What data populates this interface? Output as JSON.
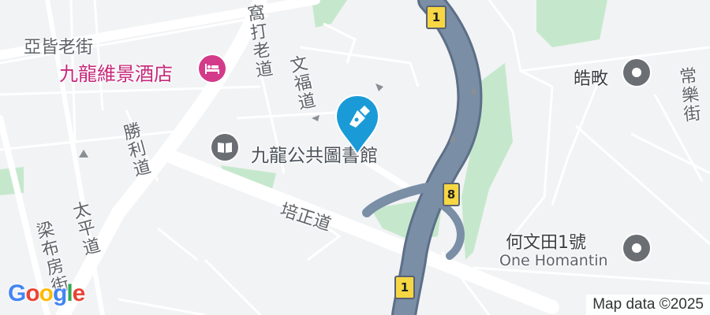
{
  "map": {
    "colors": {
      "background": "#f2f3f5",
      "green_space": "#c5e8cc",
      "major_road": "#ffffff",
      "highway": "#7a8ea6",
      "route_shield": "#f6d743",
      "poi_grey": "#6b6f74",
      "hotel_pink": "#c6287a",
      "library_label": "#4a5159",
      "marker_blue": "#1a9bd7"
    },
    "labels": {
      "street_top_left": "亞皆老街",
      "street_boundary": "窩打老道",
      "street_man_fuk": "文福道",
      "street_shing_lee": "勝利道",
      "street_tai_ping": "太平道",
      "street_leung_po": "梁布房街",
      "street_pui_ching": "培正道",
      "street_sheung_lok": "常樂街"
    },
    "pois": {
      "hotel": {
        "name": "九龍維景酒店",
        "icon": "bed-icon"
      },
      "library": {
        "name": "九龍公共圖書館",
        "icon": "book-icon"
      },
      "hau_man": {
        "name": "皓畋",
        "icon": "place-dot-icon"
      },
      "homantin": {
        "name": "何文田1號",
        "name_en": "One Homantin",
        "icon": "place-dot-icon"
      }
    },
    "shields": {
      "top": "1",
      "bottom": "1",
      "right": "8"
    },
    "marker": {
      "icon": "pen-nib-icon"
    },
    "branding": {
      "logo": "Google",
      "attribution": "Map data ©2025"
    }
  }
}
